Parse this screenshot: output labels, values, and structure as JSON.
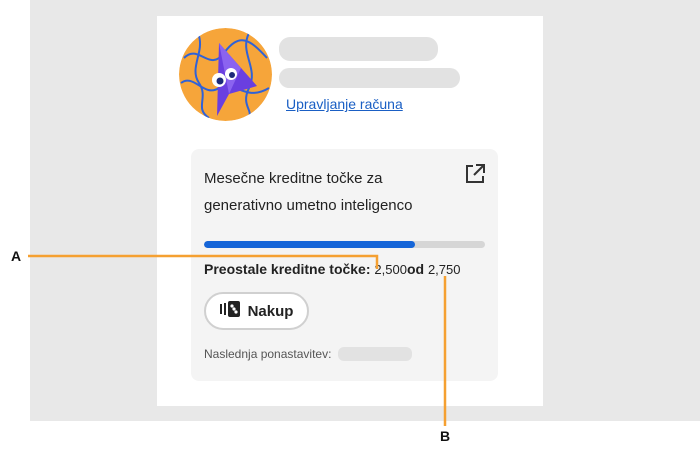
{
  "account": {
    "manage_link": "Upravljanje računa"
  },
  "credits": {
    "title": "Mesečne kreditne točke za generativno umetno inteligenco",
    "remaining_label": "Preostale kreditne točke:",
    "remaining_value": "2,500",
    "of_word": "od",
    "total_value": "2,750",
    "used_fraction": 0.75
  },
  "buy_button": {
    "label": "Nakup"
  },
  "reset": {
    "label": "Naslednja ponastavitev:"
  },
  "callouts": {
    "a": "A",
    "b": "B"
  },
  "colors": {
    "progress": "#1565d8",
    "callout_line": "#f5a031",
    "link": "#1a5fc4"
  },
  "icons": {
    "external": "external-link-icon",
    "buy": "credit-stack-icon"
  }
}
